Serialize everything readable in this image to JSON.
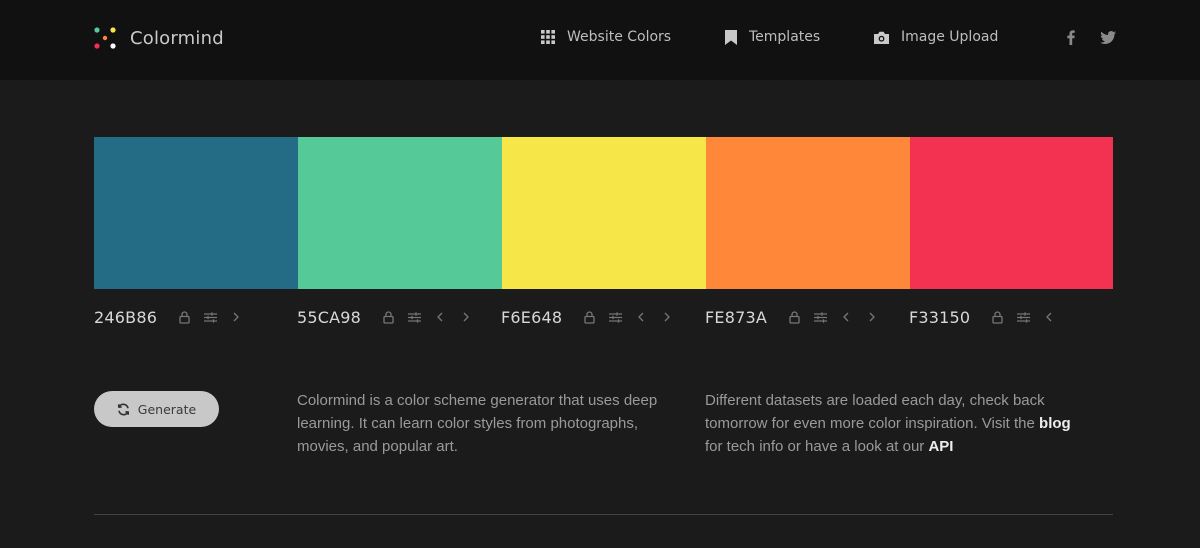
{
  "header": {
    "brand": "Colormind",
    "nav": [
      {
        "label": "Website Colors",
        "icon": "grid-icon"
      },
      {
        "label": "Templates",
        "icon": "bookmark-icon"
      },
      {
        "label": "Image Upload",
        "icon": "camera-icon"
      }
    ],
    "social": [
      "facebook-icon",
      "twitter-icon"
    ]
  },
  "palette": [
    {
      "hex": "246B86",
      "color": "#246B86",
      "controls": [
        "lock-icon",
        "adjust-icon",
        "chevron-right-icon"
      ]
    },
    {
      "hex": "55CA98",
      "color": "#55CA98",
      "controls": [
        "lock-icon",
        "adjust-icon",
        "chevron-left-icon",
        "chevron-right-icon"
      ]
    },
    {
      "hex": "F6E648",
      "color": "#F6E648",
      "controls": [
        "lock-icon",
        "adjust-icon",
        "chevron-left-icon",
        "chevron-right-icon"
      ]
    },
    {
      "hex": "FE873A",
      "color": "#FE873A",
      "controls": [
        "lock-icon",
        "adjust-icon",
        "chevron-left-icon",
        "chevron-right-icon"
      ]
    },
    {
      "hex": "F33150",
      "color": "#F33150",
      "controls": [
        "lock-icon",
        "adjust-icon",
        "chevron-left-icon"
      ]
    }
  ],
  "generate_label": "Generate",
  "intro": {
    "text": "Colormind is a color scheme generator that uses deep learning. It can learn color styles from photographs, movies, and popular art."
  },
  "datasets": {
    "text_before": "Different datasets are loaded each day, check back tomorrow for even more color inspiration. Visit the ",
    "blog_link": "blog",
    "text_middle": " for tech info or have a look at our ",
    "api_link": "API"
  }
}
